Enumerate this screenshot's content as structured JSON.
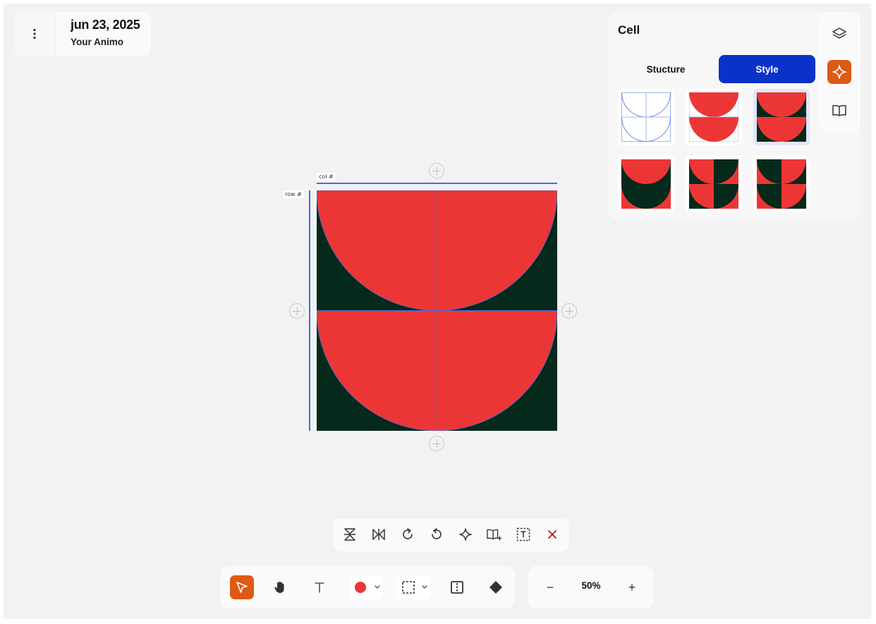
{
  "header": {
    "date": "jun 23, 2025",
    "subtitle": "Your Animo",
    "menu_icon": "more-vertical-icon"
  },
  "canvas": {
    "col_tag": "col #",
    "row_tag": "row #",
    "colors": {
      "red": "#ec3636",
      "dark": "#05291a",
      "guide": "#4a6ae0"
    }
  },
  "panel": {
    "title": "Cell",
    "tabs": [
      {
        "label": "Stucture",
        "active": false
      },
      {
        "label": "Style",
        "active": true
      }
    ],
    "swatches": [
      {
        "name": "outline",
        "selected": false
      },
      {
        "name": "red-on-white",
        "selected": false
      },
      {
        "name": "red-on-dark",
        "selected": true
      },
      {
        "name": "mixed-1",
        "selected": false
      },
      {
        "name": "mixed-2",
        "selected": false
      },
      {
        "name": "mixed-3",
        "selected": false
      }
    ],
    "side_icons": [
      "layers-icon",
      "sparkle-icon",
      "book-icon"
    ],
    "accent": "#0a32c8",
    "active_orange": "#dd5a14"
  },
  "actions": [
    "flip-vertical-icon",
    "flip-horizontal-icon",
    "rotate-cw-icon",
    "rotate-ccw-icon",
    "sparkle-icon",
    "add-to-library-icon",
    "text-frame-icon",
    "close-icon"
  ],
  "toolbar": {
    "tools": [
      "select-arrow-icon",
      "hand-icon",
      "text-tool-icon",
      "color-picker",
      "selection-box-icon",
      "split-icon",
      "fill-bucket-icon"
    ],
    "current_color": "#ec3636"
  },
  "zoom": {
    "value": "50%",
    "minus": "−",
    "plus": "+"
  }
}
